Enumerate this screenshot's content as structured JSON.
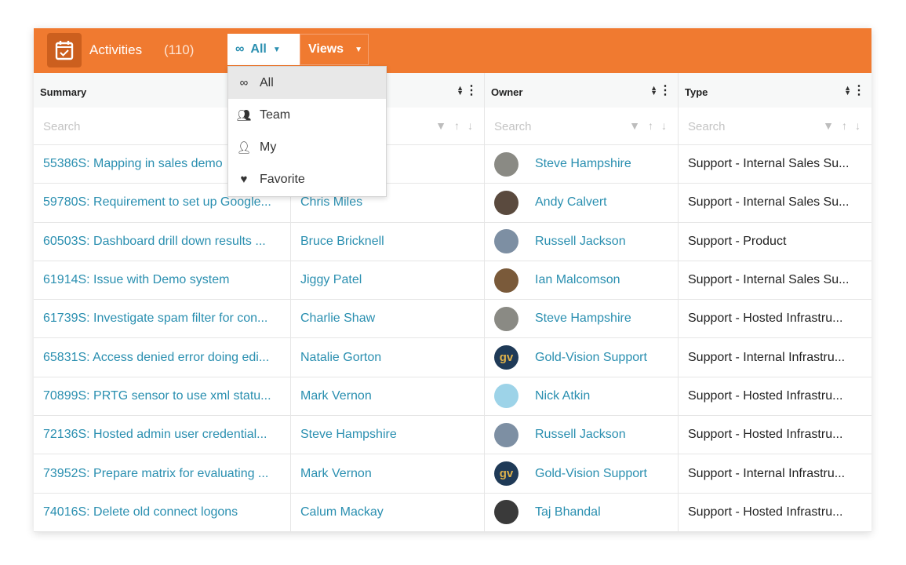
{
  "header": {
    "title": "Activities",
    "count": "(110)",
    "filter_label": "All",
    "views_label": "Views",
    "icon": "calendar-check-icon",
    "accent": "#f07a30"
  },
  "dropdown": {
    "items": [
      {
        "label": "All",
        "icon": "infinity-icon",
        "selected": true
      },
      {
        "label": "Team",
        "icon": "group-icon"
      },
      {
        "label": "My",
        "icon": "person-icon"
      },
      {
        "label": "Favorite",
        "icon": "heart-icon"
      }
    ]
  },
  "columns": [
    {
      "label": "Summary"
    },
    {
      "label": ""
    },
    {
      "label": "Owner"
    },
    {
      "label": "Type"
    }
  ],
  "search_placeholder": "Search",
  "rows": [
    {
      "summary": "55386S: Mapping in sales demo",
      "contact": "",
      "owner": "Steve Hampshire",
      "type": "Support - Internal Sales Su..."
    },
    {
      "summary": "59780S: Requirement to set up Google...",
      "contact": "Chris Miles",
      "owner": "Andy Calvert",
      "type": "Support - Internal Sales Su..."
    },
    {
      "summary": "60503S: Dashboard drill down results ...",
      "contact": "Bruce Bricknell",
      "owner": "Russell Jackson",
      "type": "Support - Product"
    },
    {
      "summary": "61914S: Issue with Demo system",
      "contact": "Jiggy Patel",
      "owner": "Ian Malcomson",
      "type": "Support - Internal Sales Su..."
    },
    {
      "summary": "61739S: Investigate spam filter for con...",
      "contact": "Charlie Shaw",
      "owner": "Steve Hampshire",
      "type": "Support - Hosted Infrastru..."
    },
    {
      "summary": "65831S: Access denied error doing edi...",
      "contact": "Natalie Gorton",
      "owner": "Gold-Vision Support",
      "type": "Support - Internal Infrastru..."
    },
    {
      "summary": "70899S: PRTG sensor to use xml statu...",
      "contact": "Mark Vernon",
      "owner": "Nick Atkin",
      "type": "Support - Hosted Infrastru..."
    },
    {
      "summary": "72136S: Hosted admin user credential...",
      "contact": "Steve Hampshire",
      "owner": "Russell Jackson",
      "type": "Support - Hosted Infrastru..."
    },
    {
      "summary": "73952S: Prepare matrix for evaluating ...",
      "contact": "Mark Vernon",
      "owner": "Gold-Vision Support",
      "type": "Support - Internal Infrastru..."
    },
    {
      "summary": "74016S: Delete old connect logons",
      "contact": "Calum Mackay",
      "owner": "Taj Bhandal",
      "type": "Support - Hosted Infrastru..."
    }
  ],
  "avatars": [
    "#8a8a84",
    "#5a4a3e",
    "#7d8fa3",
    "#7a5a3a",
    "#8a8a84",
    "gv",
    "#9dd3e8",
    "#7d8fa3",
    "gv",
    "#3a3a3a"
  ],
  "avatar_text": "gv"
}
